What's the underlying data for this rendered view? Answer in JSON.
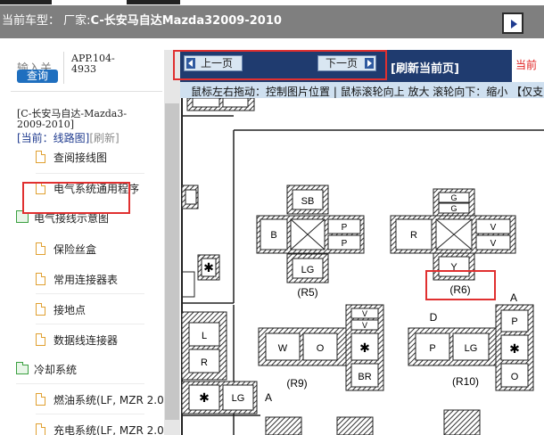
{
  "header": {
    "title_prefix": "当前车型：  厂家:",
    "title_model": "C-长安马自达Mazda32009-2010"
  },
  "sidebar": {
    "search_label": "输入关",
    "query_button": "查询",
    "app_version": "APP.104-4933",
    "vehicle_name": "[C-长安马自达-Mazda3-2009-2010]",
    "current_prefix": "[当前：线路图]",
    "refresh_link": "[刷新]",
    "items": [
      {
        "type": "file",
        "label": "查阅接线图"
      },
      {
        "type": "file",
        "label": "电气系统通用程序"
      },
      {
        "type": "folder",
        "label": "电气接线示意图"
      },
      {
        "type": "file",
        "label": "保险丝盒"
      },
      {
        "type": "file",
        "label": "常用连接器表"
      },
      {
        "type": "file",
        "label": "接地点"
      },
      {
        "type": "file",
        "label": "数据线连接器"
      },
      {
        "type": "folder",
        "label": "冷却系统"
      },
      {
        "type": "file",
        "label": "燃油系统(LF, MZR 2.0"
      },
      {
        "type": "file",
        "label": "充电系统(LF, MZR 2.0"
      }
    ]
  },
  "nav": {
    "prev_label": "上一页",
    "next_label": "下一页",
    "refresh_label": "[刷新当前页]",
    "red_text": "当前"
  },
  "hint": {
    "text": "鼠标左右拖动：控制图片位置 | 鼠标滚轮向上 放大  滚轮向下：缩小 【仅支"
  },
  "diagram": {
    "r5": {
      "caption": "(R5)",
      "top": "SB",
      "left": "B",
      "right_top": "P",
      "right_bottom": "P",
      "bottom": "LG"
    },
    "r6": {
      "caption": "(R6)",
      "top_top": "G",
      "top_bottom": "G",
      "left": "R",
      "right_top": "V",
      "right_bottom": "V",
      "bottom": "Y"
    },
    "r9": {
      "caption": "(R9)",
      "left": "W",
      "center": "O",
      "right_top": "V",
      "right_bottom": "V",
      "star": "✱",
      "bottom": "BR"
    },
    "r10": {
      "caption": "(R10)",
      "left": "P",
      "center": "LG",
      "top_label": "D"
    },
    "a_block": {
      "label": "A",
      "top": "P",
      "star": "✱",
      "bottom": "O"
    },
    "left_block": {
      "top": "L",
      "bottom": "R"
    },
    "left_bottom": {
      "star": "✱",
      "right": "LG",
      "a": "A"
    },
    "upper_star": "✱"
  }
}
